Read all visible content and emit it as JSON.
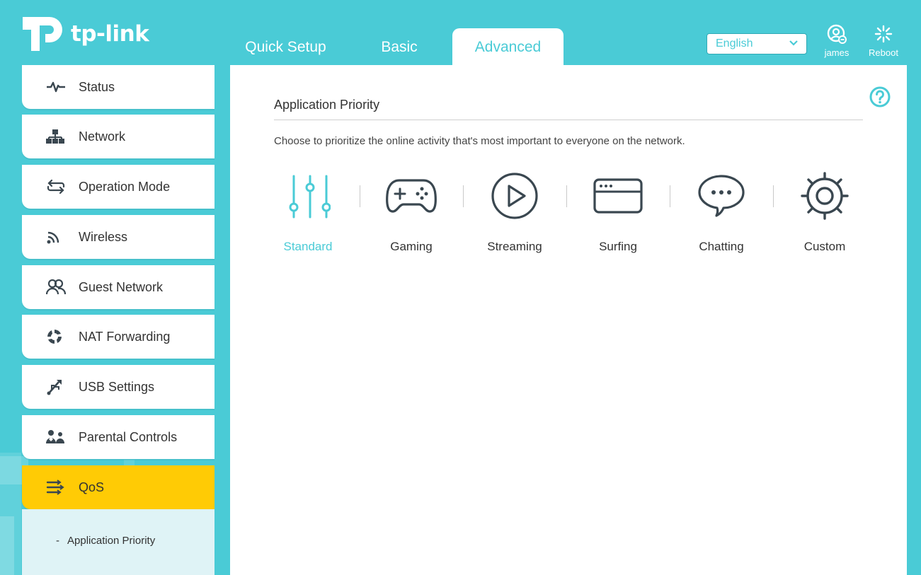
{
  "brand": {
    "logo_text": "tp-link"
  },
  "tabs": [
    {
      "label": "Quick Setup",
      "active": false
    },
    {
      "label": "Basic",
      "active": false
    },
    {
      "label": "Advanced",
      "active": true
    }
  ],
  "language": {
    "selected": "English"
  },
  "header_buttons": {
    "user_label": "james",
    "reboot_label": "Reboot"
  },
  "sidebar": {
    "items": [
      {
        "label": "Status",
        "icon": "pulse-icon"
      },
      {
        "label": "Network",
        "icon": "network-icon"
      },
      {
        "label": "Operation Mode",
        "icon": "swap-arrows-icon"
      },
      {
        "label": "Wireless",
        "icon": "wifi-icon"
      },
      {
        "label": "Guest Network",
        "icon": "users-icon"
      },
      {
        "label": "NAT Forwarding",
        "icon": "nat-icon"
      },
      {
        "label": "USB Settings",
        "icon": "usb-icon"
      },
      {
        "label": "Parental Controls",
        "icon": "family-icon"
      },
      {
        "label": "QoS",
        "icon": "qos-icon",
        "active": true
      }
    ],
    "submenu": [
      {
        "label": "Application Priority",
        "active": true
      }
    ]
  },
  "main": {
    "title": "Application Priority",
    "description": "Choose to prioritize the online activity that's most important to everyone on the network.",
    "apps": [
      {
        "label": "Standard",
        "icon": "sliders-icon",
        "active": true
      },
      {
        "label": "Gaming",
        "icon": "gamepad-icon",
        "active": false
      },
      {
        "label": "Streaming",
        "icon": "play-icon",
        "active": false
      },
      {
        "label": "Surfing",
        "icon": "browser-icon",
        "active": false
      },
      {
        "label": "Chatting",
        "icon": "chat-bubble-icon",
        "active": false
      },
      {
        "label": "Custom",
        "icon": "gear-icon",
        "active": false
      }
    ]
  },
  "colors": {
    "accent": "#4acbd6",
    "active_nav": "#ffcb05",
    "icon_dark": "#3a4750"
  }
}
